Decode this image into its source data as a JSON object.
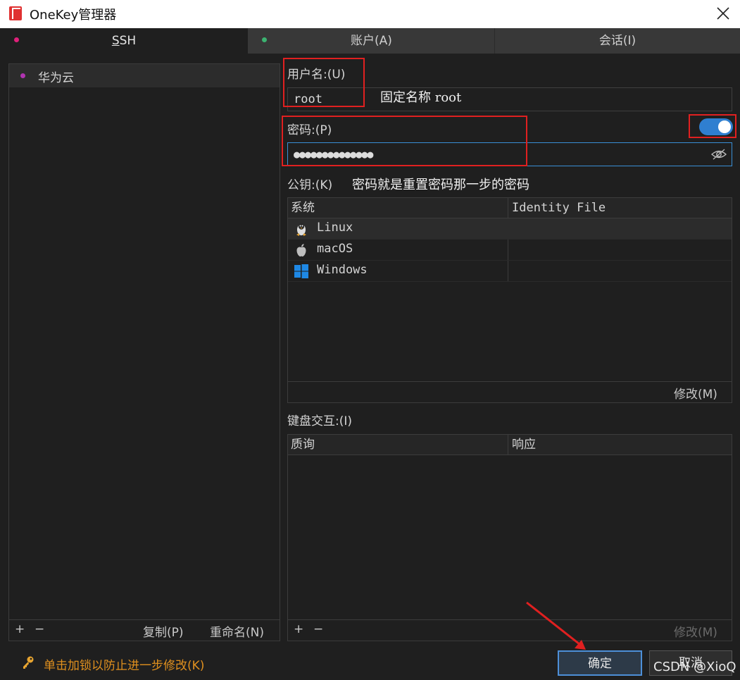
{
  "window": {
    "title": "OneKey管理器",
    "close_icon": "close-icon"
  },
  "tabs": [
    {
      "label": "SSH",
      "mnemonic": "S",
      "dot_color": "#e0207a"
    },
    {
      "label": "账户(A)",
      "dot_color": "#3cb371"
    },
    {
      "label": "会话(I)"
    }
  ],
  "sidebar": {
    "items": [
      {
        "label": "华为云",
        "dot_color": "#b034b0"
      }
    ],
    "footer": {
      "add": "+",
      "remove": "−",
      "copy": "复制(P)",
      "rename": "重命名(N)"
    }
  },
  "form": {
    "username_label": "用户名:(U)",
    "username_value": "root",
    "password_label": "密码:(P)",
    "password_value": "●●●●●●●●●●●●●●",
    "password_toggle_on": true,
    "pubkey_label": "公钥:(K)",
    "kbd_label": "键盘交互:(I)"
  },
  "pubkey_table": {
    "columns": [
      "系统",
      "Identity File"
    ],
    "rows": [
      {
        "os": "Linux",
        "icon": "linux-icon",
        "identity": ""
      },
      {
        "os": "macOS",
        "icon": "apple-icon",
        "identity": ""
      },
      {
        "os": "Windows",
        "icon": "windows-icon",
        "identity": ""
      }
    ],
    "edit_button": "修改(M)"
  },
  "kbd_table": {
    "columns": [
      "质询",
      "响应"
    ],
    "footer": {
      "add": "+",
      "remove": "−",
      "edit": "修改(M)"
    }
  },
  "annotations": {
    "username_note": "固定名称 root",
    "pubkey_note": "密码就是重置密码那一步的密码"
  },
  "footer": {
    "lock_hint": "单击加锁以防止进一步修改(K)",
    "ok_button": "确定",
    "cancel_button": "取消",
    "watermark": "CSDN @XioQ"
  },
  "colors": {
    "accent": "#2f7fd0",
    "warning": "#e0901e",
    "annotation": "#e02020"
  }
}
